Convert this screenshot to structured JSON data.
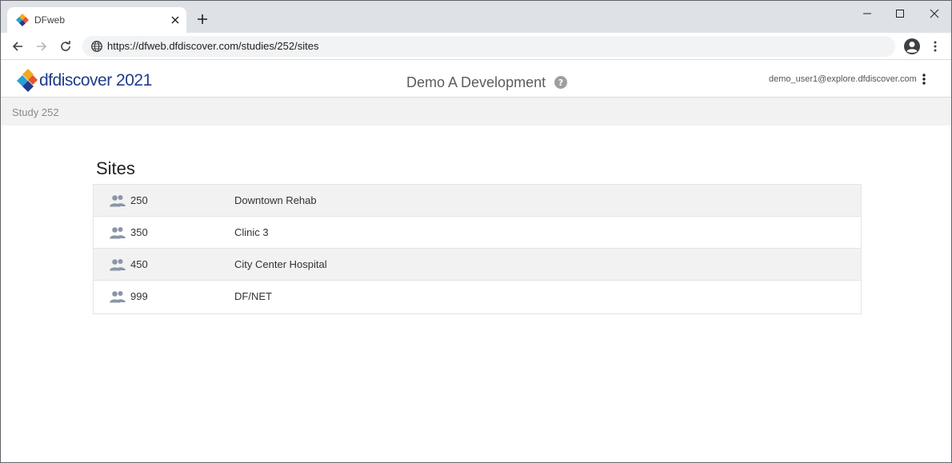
{
  "browser": {
    "tab_title": "DFweb",
    "url": "https://dfweb.dfdiscover.com/studies/252/sites"
  },
  "app": {
    "logo_text": "dfdiscover 2021",
    "title": "Demo A Development",
    "user_email": "demo_user1@explore.dfdiscover.com"
  },
  "breadcrumb": {
    "study": "Study 252"
  },
  "main": {
    "heading": "Sites",
    "sites": [
      {
        "number": "250",
        "name": "Downtown Rehab"
      },
      {
        "number": "350",
        "name": "Clinic 3"
      },
      {
        "number": "450",
        "name": "City Center Hospital"
      },
      {
        "number": "999",
        "name": "DF/NET"
      }
    ]
  },
  "icons": {
    "favicon": "dfdiscover-logo-icon",
    "site": "people-group-icon",
    "help": "help-circle-icon",
    "menu": "kebab-menu-icon"
  },
  "colors": {
    "brand_blue": "#1f3d8c",
    "row_shade": "#f2f2f2",
    "icon_gray": "#8a96a8"
  }
}
